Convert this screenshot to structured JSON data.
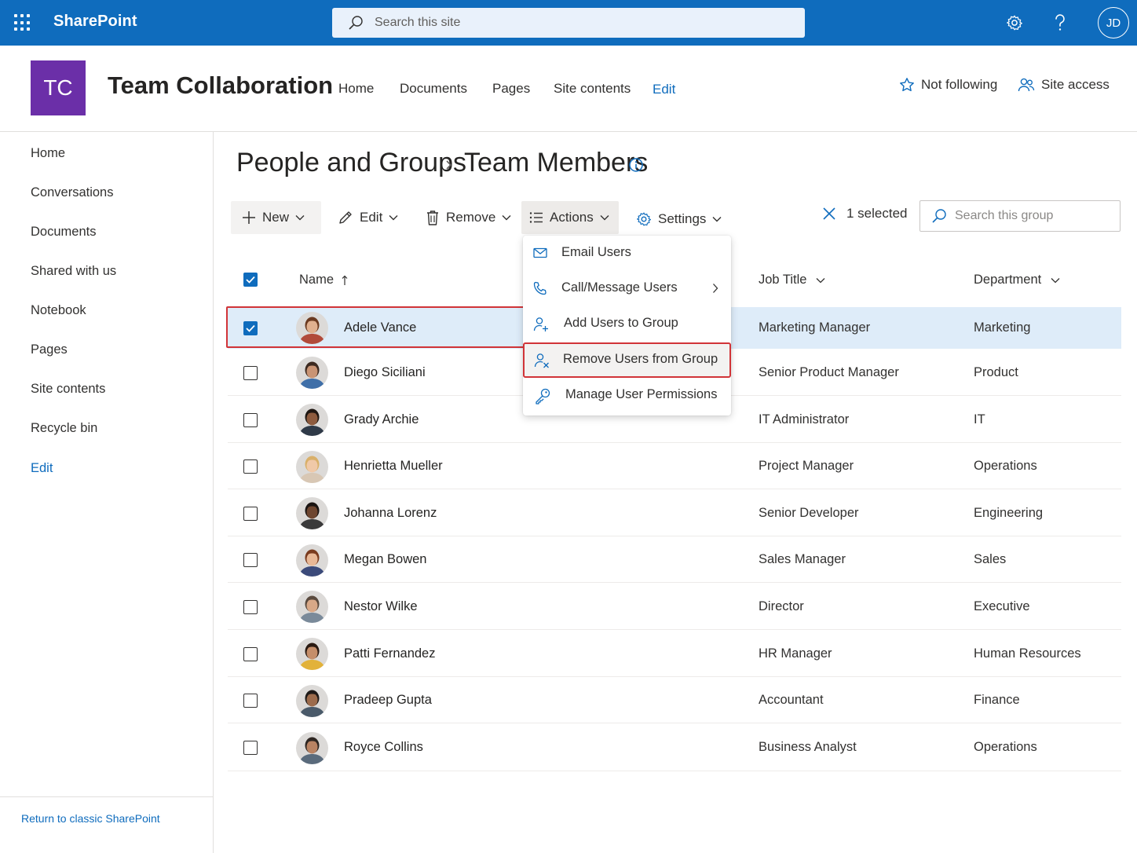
{
  "suite": {
    "brand": "SharePoint",
    "search_placeholder": "Search this site",
    "user_initials": "JD"
  },
  "site": {
    "logo_text": "TC",
    "title": "Team Collaboration",
    "nav": [
      "Home",
      "Documents",
      "Pages",
      "Site contents",
      "Edit"
    ],
    "follow_label": "Not following",
    "access_label": "Site access"
  },
  "leftnav": {
    "items": [
      "Home",
      "Conversations",
      "Documents",
      "Shared with us",
      "Notebook",
      "Pages",
      "Site contents",
      "Recycle bin",
      "Edit"
    ],
    "footer_link": "Return to classic SharePoint"
  },
  "breadcrumb": {
    "parent": "People and Groups",
    "current": "Team Members"
  },
  "commandbar": {
    "new": "New",
    "edit": "Edit",
    "remove": "Remove",
    "actions": "Actions",
    "settings": "Settings",
    "selected_text": "1 selected",
    "search_placeholder": "Search this group"
  },
  "table": {
    "columns": {
      "name": "Name",
      "job": "Job Title",
      "dept": "Department"
    },
    "rows": [
      {
        "name": "Adele Vance",
        "job": "Marketing Manager",
        "dept": "Marketing",
        "selected": true
      },
      {
        "name": "Diego Siciliani",
        "job": "Senior Product Manager",
        "dept": "Product",
        "selected": false
      },
      {
        "name": "Grady Archie",
        "job": "IT Administrator",
        "dept": "IT",
        "selected": false
      },
      {
        "name": "Henrietta Mueller",
        "job": "Project Manager",
        "dept": "Operations",
        "selected": false
      },
      {
        "name": "Johanna Lorenz",
        "job": "Senior Developer",
        "dept": "Engineering",
        "selected": false
      },
      {
        "name": "Megan Bowen",
        "job": "Sales Manager",
        "dept": "Sales",
        "selected": false
      },
      {
        "name": "Nestor Wilke",
        "job": "Director",
        "dept": "Executive",
        "selected": false
      },
      {
        "name": "Patti Fernandez",
        "job": "HR Manager",
        "dept": "Human Resources",
        "selected": false
      },
      {
        "name": "Pradeep Gupta",
        "job": "Accountant",
        "dept": "Finance",
        "selected": false
      },
      {
        "name": "Royce Collins",
        "job": "Business Analyst",
        "dept": "Operations",
        "selected": false
      }
    ]
  },
  "actions_menu": {
    "items": [
      "Email Users",
      "Call/Message Users",
      "Add Users to Group",
      "Remove Users from Group",
      "Manage User Permissions"
    ]
  },
  "colors": {
    "suite_bar": "#0f6cbd",
    "site_logo": "#6b2fa8",
    "selection": "#deecf9",
    "highlight_outline": "#d13438"
  }
}
